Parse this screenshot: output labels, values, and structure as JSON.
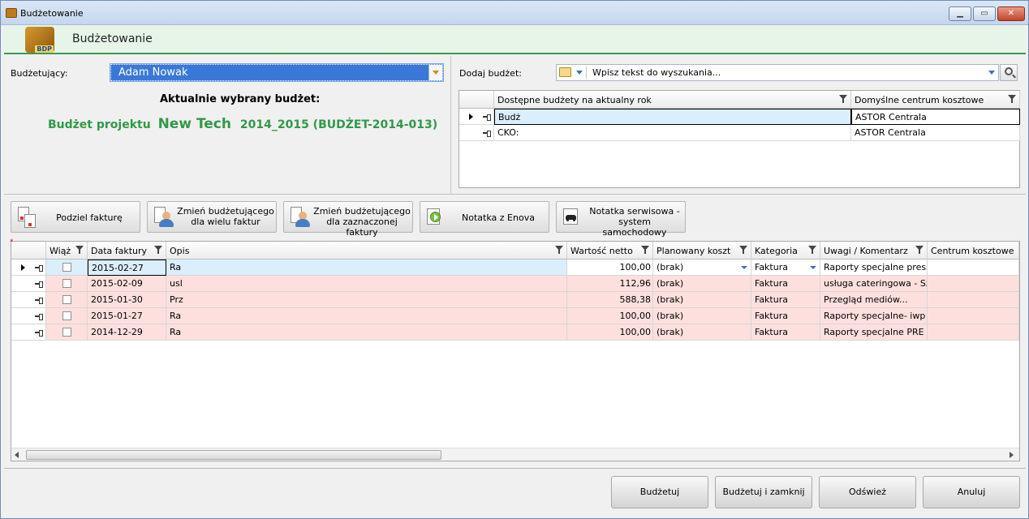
{
  "window": {
    "title": "Budżetowanie"
  },
  "header": {
    "title": "Budżetowanie",
    "logo_text": "BDP"
  },
  "left": {
    "budgetor_label": "Budżetujący:",
    "budgetor_value": "Adam Nowak",
    "current_label": "Aktualnie wybrany budżet:",
    "current_prefix": "Budżet projektu",
    "current_name": "New Tech",
    "current_suffix": "2014_2015 (BUDŻET-2014-013)"
  },
  "right": {
    "add_label": "Dodaj budżet:",
    "search_placeholder": "Wpisz tekst do wyszukania...",
    "columns": [
      "Dostępne budżety na aktualny rok",
      "Domyślne centrum kosztowe"
    ],
    "rows": [
      {
        "name": "Budż",
        "center": "ASTOR Centrala"
      },
      {
        "name": "CKO:",
        "center": "ASTOR Centrala"
      }
    ]
  },
  "toolbar": [
    {
      "label": "Podziel fakturę"
    },
    {
      "label": "Zmień budżetującego\ndla wielu faktur"
    },
    {
      "label": "Zmień budżetującego\ndla zaznaczonej faktury"
    },
    {
      "label": "Notatka z Enova"
    },
    {
      "label": "Notatka serwisowa -\nsystem samochodowy"
    }
  ],
  "invoices": {
    "columns": [
      "Wiąż",
      "Data faktury",
      "Opis",
      "Wartość netto",
      "Planowany koszt",
      "Kategoria",
      "Uwagi / Komentarz",
      "Centrum kosztowe"
    ],
    "rows": [
      {
        "date": "2015-02-27",
        "desc": "Ra",
        "value": "100,00",
        "plan": "(brak)",
        "cat": "Faktura",
        "note": "Raporty specjalne press",
        "center": ""
      },
      {
        "date": "2015-02-09",
        "desc": "usl",
        "value": "112,96",
        "plan": "(brak)",
        "cat": "Faktura",
        "note": "usługa cateringowa - Sz",
        "center": ""
      },
      {
        "date": "2015-01-30",
        "desc": "Prz",
        "value": "588,38",
        "plan": "(brak)",
        "cat": "Faktura",
        "note": "Przegląd mediów...",
        "center": ""
      },
      {
        "date": "2015-01-27",
        "desc": "Ra",
        "value": "100,00",
        "plan": "(brak)",
        "cat": "Faktura",
        "note": "Raporty specjalne- iwp",
        "center": ""
      },
      {
        "date": "2014-12-29",
        "desc": "Ra",
        "value": "100,00",
        "plan": "(brak)",
        "cat": "Faktura",
        "note": "Raporty specjalne PRE",
        "center": ""
      }
    ]
  },
  "buttons": {
    "budget": "Budżetuj",
    "budget_close": "Budżetuj i zamknij",
    "refresh": "Odśwież",
    "cancel": "Anuluj"
  },
  "colors": {
    "accent_green": "#2f9a47",
    "selection_blue": "#3a78d8",
    "row_pink": "#fde0de",
    "row_selected": "#dbeefc"
  }
}
